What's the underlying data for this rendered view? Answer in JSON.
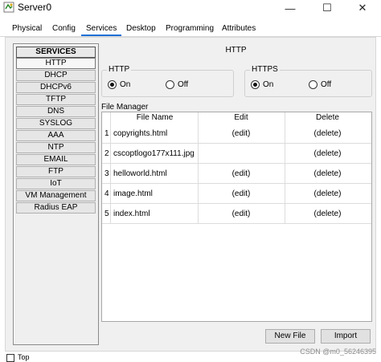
{
  "window": {
    "title": "Server0",
    "icon": "server-icon",
    "controls": {
      "minimize": "—",
      "maximize": "☐",
      "close": "✕"
    }
  },
  "tabs": [
    {
      "label": "Physical"
    },
    {
      "label": "Config"
    },
    {
      "label": "Services",
      "active": true
    },
    {
      "label": "Desktop"
    },
    {
      "label": "Programming"
    },
    {
      "label": "Attributes"
    }
  ],
  "services": {
    "header": "SERVICES",
    "items": [
      "HTTP",
      "DHCP",
      "DHCPv6",
      "TFTP",
      "DNS",
      "SYSLOG",
      "AAA",
      "NTP",
      "EMAIL",
      "FTP",
      "IoT",
      "VM Management",
      "Radius EAP"
    ],
    "selected": "HTTP"
  },
  "panel": {
    "title": "HTTP",
    "http": {
      "label": "HTTP",
      "on": "On",
      "off": "Off",
      "selected": "On"
    },
    "https": {
      "label": "HTTPS",
      "on": "On",
      "off": "Off",
      "selected": "On"
    }
  },
  "file_manager": {
    "label": "File Manager",
    "headers": {
      "name": "File Name",
      "edit": "Edit",
      "delete": "Delete"
    },
    "rows": [
      {
        "num": "1",
        "name": "copyrights.html",
        "edit": "(edit)",
        "delete": "(delete)"
      },
      {
        "num": "2",
        "name": "cscoptlogo177x111.jpg",
        "edit": "",
        "delete": "(delete)"
      },
      {
        "num": "3",
        "name": "helloworld.html",
        "edit": "(edit)",
        "delete": "(delete)"
      },
      {
        "num": "4",
        "name": "image.html",
        "edit": "(edit)",
        "delete": "(delete)"
      },
      {
        "num": "5",
        "name": "index.html",
        "edit": "(edit)",
        "delete": "(delete)"
      }
    ]
  },
  "buttons": {
    "new_file": "New File",
    "import": "Import"
  },
  "status": {
    "checkbox_label": "Top"
  },
  "watermark": "CSDN @m0_56246395"
}
